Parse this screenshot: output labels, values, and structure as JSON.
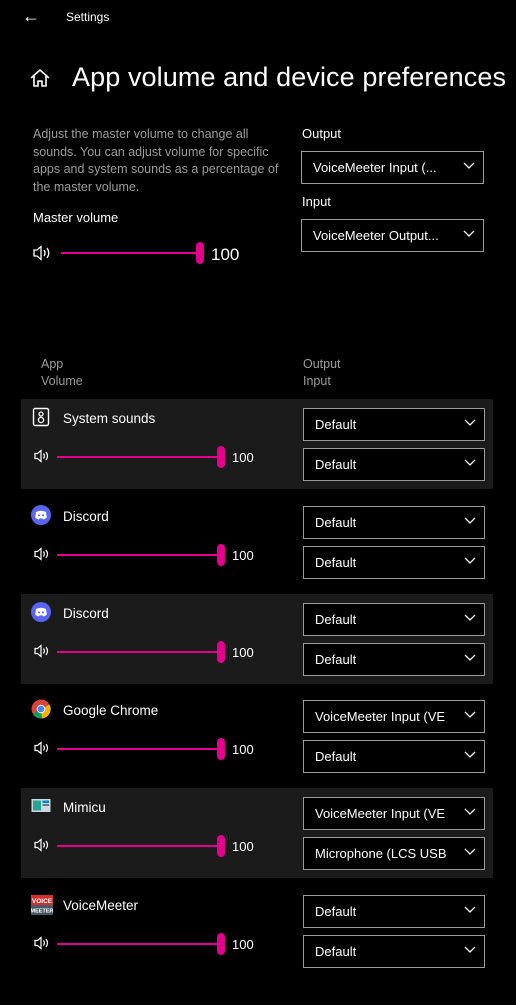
{
  "titlebar": {
    "back_icon": "back-arrow-icon",
    "title": "Settings"
  },
  "page": {
    "title": "App volume and device preferences",
    "home_icon": "home-icon"
  },
  "description": "Adjust the master volume to change all sounds. You can adjust volume for specific apps and system sounds as a percentage of the master volume.",
  "master": {
    "label": "Master volume",
    "value": "100",
    "level": 1.0,
    "output_label": "Output",
    "output_value": "VoiceMeeter Input (...",
    "input_label": "Input",
    "input_value": "VoiceMeeter Output..."
  },
  "headers": {
    "app": "App",
    "volume": "Volume",
    "output": "Output",
    "input": "Input"
  },
  "accent": "#e3008c",
  "apps": [
    {
      "name": "System sounds",
      "icon": "system-sounds-icon",
      "volume": "100",
      "output": "Default",
      "input": "Default"
    },
    {
      "name": "Discord",
      "icon": "discord-icon",
      "volume": "100",
      "output": "Default",
      "input": "Default"
    },
    {
      "name": "Discord",
      "icon": "discord-icon",
      "volume": "100",
      "output": "Default",
      "input": "Default"
    },
    {
      "name": "Google Chrome",
      "icon": "chrome-icon",
      "volume": "100",
      "output": "VoiceMeeter Input (VE",
      "input": "Default"
    },
    {
      "name": "Mimicu",
      "icon": "mimicu-icon",
      "volume": "100",
      "output": "VoiceMeeter Input (VE",
      "input": "Microphone (LCS USB"
    },
    {
      "name": "VoiceMeeter",
      "icon": "voicemeeter-icon",
      "volume": "100",
      "output": "Default",
      "input": "Default"
    }
  ]
}
